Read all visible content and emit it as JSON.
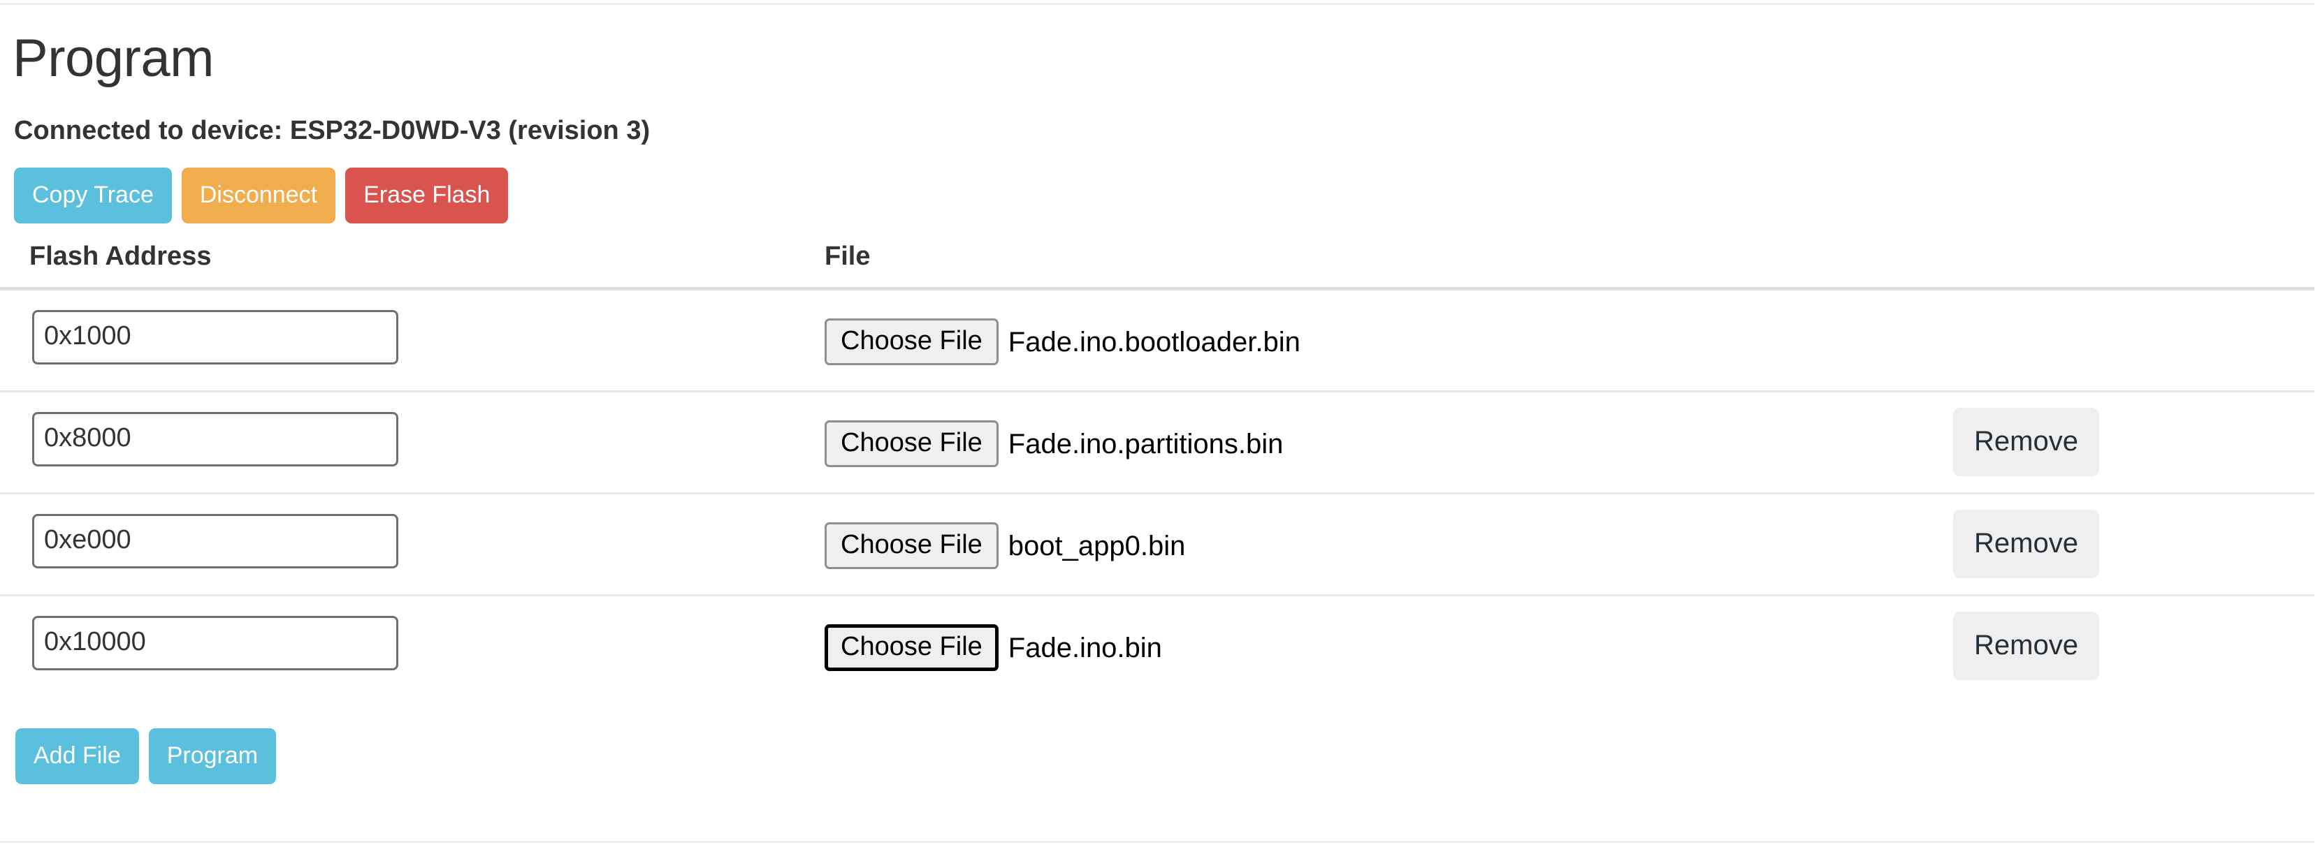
{
  "page": {
    "title": "Program",
    "device_status": "Connected to device: ESP32-D0WD-V3 (revision 3)"
  },
  "colors": {
    "info": "#5bc0de",
    "warning": "#f0ad4e",
    "danger": "#d9534f",
    "neutral_button": "#efefef",
    "text": "#333333",
    "divider": "#e8e8e8",
    "header_divider": "#dddddd"
  },
  "actions": {
    "copy_trace_label": "Copy Trace",
    "disconnect_label": "Disconnect",
    "erase_flash_label": "Erase Flash"
  },
  "table": {
    "headers": {
      "address": "Flash Address",
      "file": "File"
    },
    "choose_file_label": "Choose File",
    "remove_label": "Remove",
    "rows": [
      {
        "address": "0x1000",
        "address_placeholder": "0x0",
        "file_name": "Fade.ino.bootloader.bin",
        "has_remove": false,
        "file_input_focused": false
      },
      {
        "address": "0x8000",
        "address_placeholder": "0x0",
        "file_name": "Fade.ino.partitions.bin",
        "has_remove": true,
        "file_input_focused": false
      },
      {
        "address": "0xe000",
        "address_placeholder": "0x0",
        "file_name": "boot_app0.bin",
        "has_remove": true,
        "file_input_focused": false
      },
      {
        "address": "0x10000",
        "address_placeholder": "0x0",
        "file_name": "Fade.ino.bin",
        "has_remove": true,
        "file_input_focused": true
      }
    ]
  },
  "footer": {
    "add_file_label": "Add File",
    "program_label": "Program"
  }
}
